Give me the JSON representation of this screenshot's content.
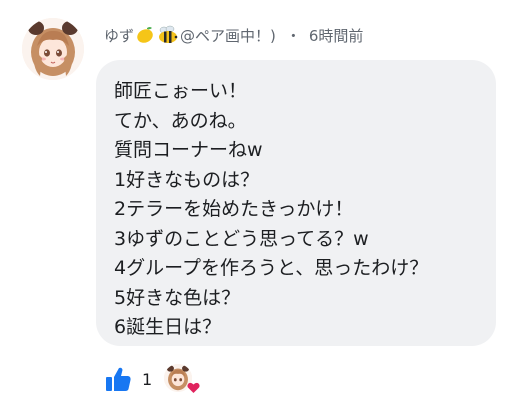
{
  "comment": {
    "author": {
      "name": "ゆず",
      "suffix": "@ペア画中！)"
    },
    "meta_separator": "・",
    "time": "6時間前",
    "lines": [
      "師匠こぉーい！",
      "てか、あのね。",
      "質問コーナーねw",
      "1好きなものは？",
      "2テラーを始めたきっかけ！",
      "3ゆずのことどう思ってる？w",
      "4グループを作ろうと、思ったわけ？",
      "5好きな色は？",
      "6誕生日は？"
    ],
    "reactions": {
      "like_count": "1"
    }
  },
  "colors": {
    "bubble_bg": "#f0f1f3",
    "like_blue": "#1877f2",
    "heart_red": "#e0245e",
    "meta_gray": "#606770"
  },
  "icons": {
    "author_badges": [
      "lemon-icon",
      "bee-icon"
    ],
    "like": "thumbs-up-icon",
    "reactor_badge": "heart-icon"
  }
}
